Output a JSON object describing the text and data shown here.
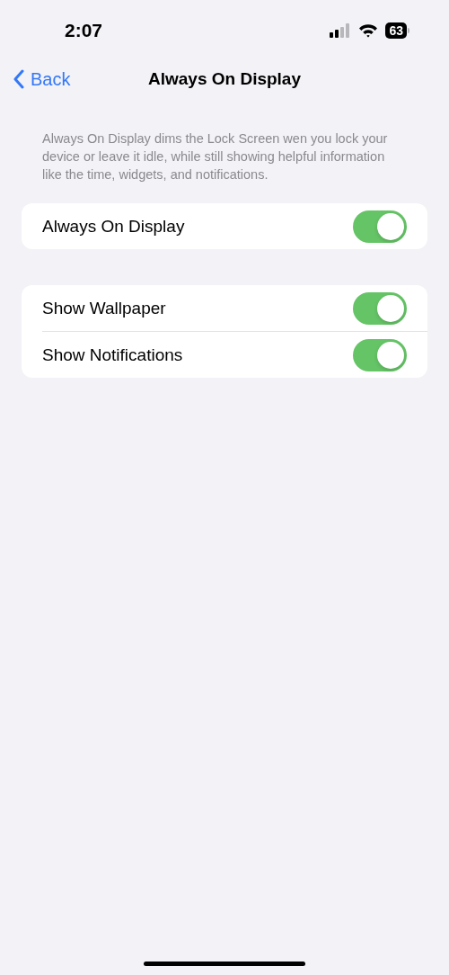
{
  "status_bar": {
    "time": "2:07",
    "battery": "63"
  },
  "nav": {
    "back": "Back",
    "title": "Always On Display"
  },
  "description": "Always On Display dims the Lock Screen wen you lock your device or leave it idle, while still showing helpful information like the time, widgets, and notifications.",
  "groups": [
    {
      "rows": [
        {
          "label": "Always On Display",
          "on": true
        }
      ]
    },
    {
      "rows": [
        {
          "label": "Show Wallpaper",
          "on": true
        },
        {
          "label": "Show Notifications",
          "on": true
        }
      ]
    }
  ]
}
